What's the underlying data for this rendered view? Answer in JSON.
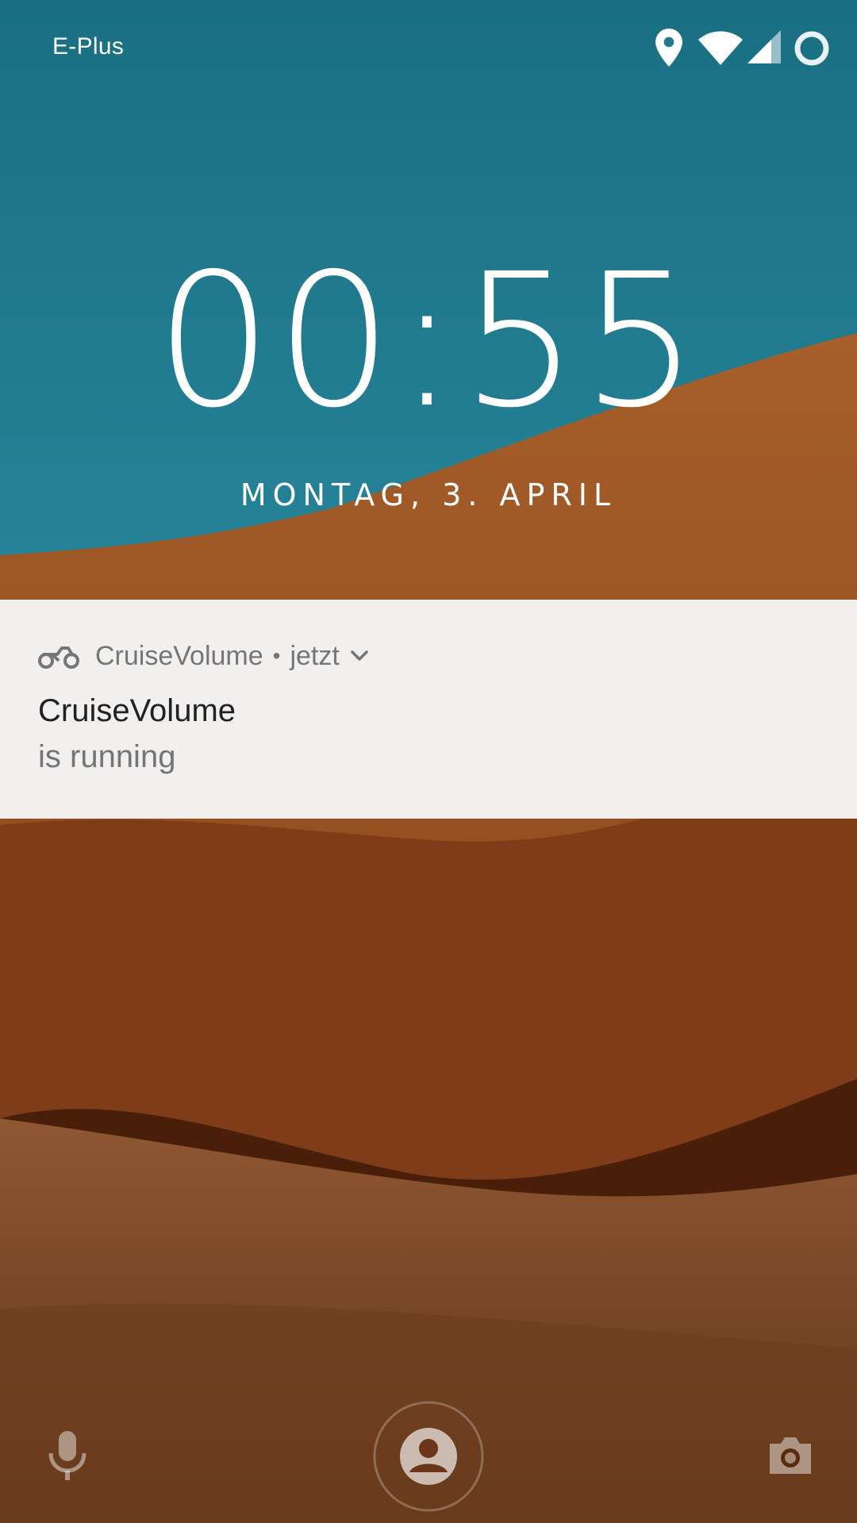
{
  "status_bar": {
    "carrier": "E-Plus",
    "icons": [
      "location-icon",
      "wifi-icon",
      "cell-signal-icon",
      "battery-charging-icon"
    ]
  },
  "lockscreen": {
    "time": "00:55",
    "date": "MONTAG, 3. APRIL"
  },
  "notification": {
    "app_name": "CruiseVolume",
    "separator": "•",
    "timestamp": "jetzt",
    "title": "CruiseVolume",
    "text": "is running",
    "app_icon": "motorcycle-icon",
    "expand_icon": "chevron-down-icon"
  },
  "bottom_bar": {
    "left_icon": "microphone-icon",
    "center_icon": "user-avatar-icon",
    "right_icon": "camera-icon"
  },
  "colors": {
    "sky": "#1f7a8c",
    "dune": "#8c4a1e",
    "notification_bg": "#f2f0ef",
    "text_primary": "#212121",
    "text_secondary": "#757575"
  }
}
